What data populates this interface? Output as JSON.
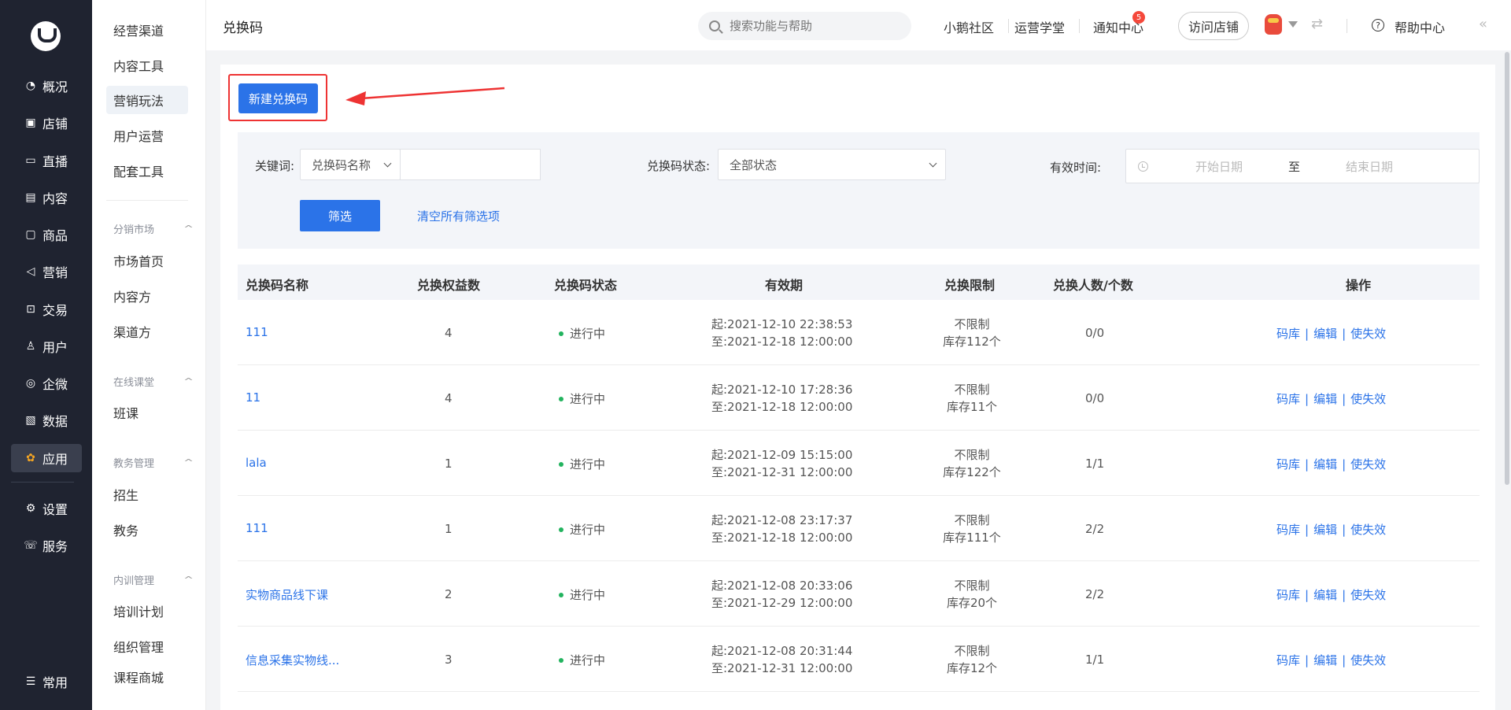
{
  "nav": {
    "items": [
      {
        "icon": "pie-chart-icon",
        "label": "概况"
      },
      {
        "icon": "store-icon",
        "label": "店铺"
      },
      {
        "icon": "live-icon",
        "label": "直播"
      },
      {
        "icon": "content-icon",
        "label": "内容"
      },
      {
        "icon": "goods-icon",
        "label": "商品"
      },
      {
        "icon": "megaphone-icon",
        "label": "营销"
      },
      {
        "icon": "trade-icon",
        "label": "交易"
      },
      {
        "icon": "user-icon",
        "label": "用户"
      },
      {
        "icon": "wecom-icon",
        "label": "企微"
      },
      {
        "icon": "data-icon",
        "label": "数据"
      },
      {
        "icon": "apps-icon",
        "label": "应用"
      },
      {
        "icon": "gear-icon",
        "label": "设置"
      },
      {
        "icon": "service-icon",
        "label": "服务"
      }
    ],
    "common": "常用"
  },
  "side2": {
    "top_items": [
      "经营渠道",
      "内容工具",
      "营销玩法",
      "用户运营",
      "配套工具"
    ],
    "groups": [
      {
        "title": "分销市场",
        "items": [
          "市场首页",
          "内容方",
          "渠道方"
        ]
      },
      {
        "title": "在线课堂",
        "items": [
          "班课"
        ]
      },
      {
        "title": "教务管理",
        "items": [
          "招生",
          "教务"
        ]
      },
      {
        "title": "内训管理",
        "items": [
          "培训计划",
          "组织管理",
          "课程商城"
        ]
      }
    ]
  },
  "header": {
    "title": "兑换码",
    "search_placeholder": "搜索功能与帮助",
    "links": [
      "小鹅社区",
      "运营学堂",
      "通知中心"
    ],
    "notify_count": "5",
    "visit_store": "访问店铺",
    "help": "帮助中心"
  },
  "main": {
    "new_button": "新建兑换码",
    "filter": {
      "keyword_label": "关键词:",
      "keyword_select": "兑换码名称",
      "keyword_value": "",
      "status_label": "兑换码状态:",
      "status_select": "全部状态",
      "time_label": "有效时间:",
      "start_placeholder": "开始日期",
      "to": "至",
      "end_placeholder": "结束日期",
      "filter_button": "筛选",
      "clear_link": "清空所有筛选项"
    },
    "table": {
      "headers": [
        "兑换码名称",
        "兑换权益数",
        "兑换码状态",
        "有效期",
        "兑换限制",
        "兑换人数/个数",
        "操作"
      ],
      "rows": [
        {
          "name": "111",
          "count": "4",
          "status": "进行中",
          "start": "起:2021-12-10 22:38:53",
          "end": "至:2021-12-18 12:00:00",
          "limit": "不限制",
          "stock": "库存112个",
          "used": "0/0"
        },
        {
          "name": "11",
          "count": "4",
          "status": "进行中",
          "start": "起:2021-12-10 17:28:36",
          "end": "至:2021-12-18 12:00:00",
          "limit": "不限制",
          "stock": "库存11个",
          "used": "0/0"
        },
        {
          "name": "lala",
          "count": "1",
          "status": "进行中",
          "start": "起:2021-12-09 15:15:00",
          "end": "至:2021-12-31 12:00:00",
          "limit": "不限制",
          "stock": "库存122个",
          "used": "1/1"
        },
        {
          "name": "111",
          "count": "1",
          "status": "进行中",
          "start": "起:2021-12-08 23:17:37",
          "end": "至:2021-12-18 12:00:00",
          "limit": "不限制",
          "stock": "库存111个",
          "used": "2/2"
        },
        {
          "name": "实物商品线下课",
          "count": "2",
          "status": "进行中",
          "start": "起:2021-12-08 20:33:06",
          "end": "至:2021-12-29 12:00:00",
          "limit": "不限制",
          "stock": "库存20个",
          "used": "2/2"
        },
        {
          "name": "信息采集实物线...",
          "count": "3",
          "status": "进行中",
          "start": "起:2021-12-08 20:31:44",
          "end": "至:2021-12-31 12:00:00",
          "limit": "不限制",
          "stock": "库存12个",
          "used": "1/1"
        }
      ],
      "ops": [
        "码库",
        "编辑",
        "使失效"
      ],
      "op_sep": "|"
    }
  },
  "colors": {
    "accent": "#2b73e8",
    "nav_bg": "#1f2330",
    "status_green": "#22b35e",
    "highlight": "#e33333"
  }
}
